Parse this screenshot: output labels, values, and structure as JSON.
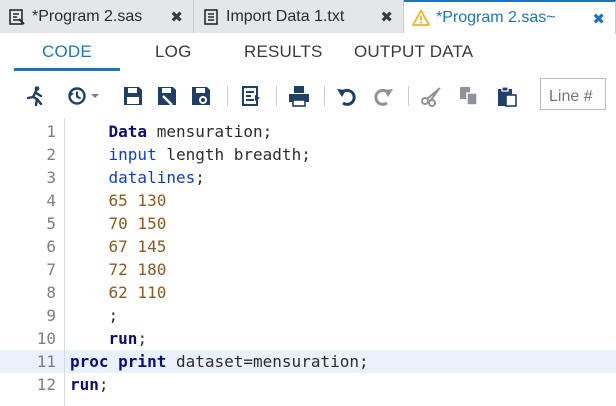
{
  "tabs": [
    {
      "label": "*Program 2.sas",
      "close": "✖",
      "icon": "program-icon",
      "active": false
    },
    {
      "label": "Import Data 1.txt",
      "close": "✖",
      "icon": "document-icon",
      "active": false
    },
    {
      "label": "*Program 2.sas~",
      "close": "✖",
      "icon": "warning-icon",
      "active": true
    }
  ],
  "subtabs": [
    "CODE",
    "LOG",
    "RESULTS",
    "OUTPUT DATA"
  ],
  "toolbar": {
    "line_placeholder": "Line #",
    "icons": [
      "run-icon",
      "history-icon",
      "save-icon",
      "save-as-icon",
      "save-to-icon",
      "format-icon",
      "print-icon",
      "undo-icon",
      "redo-icon",
      "cut-icon",
      "copy-icon",
      "paste-icon"
    ]
  },
  "colors": {
    "accent": "#1e74b9",
    "keyword": "#0b0b80",
    "number": "#8a5a1e",
    "warning": "#f2b21d"
  },
  "editor": {
    "current_line": 11,
    "lines": [
      {
        "n": "1",
        "indent": "    ",
        "tokens": [
          {
            "t": "Data",
            "c": "kw"
          },
          {
            "t": " mensuration;",
            "c": "plain"
          }
        ]
      },
      {
        "n": "2",
        "indent": "    ",
        "tokens": [
          {
            "t": "input",
            "c": "kw2"
          },
          {
            "t": " length breadth;",
            "c": "plain"
          }
        ]
      },
      {
        "n": "3",
        "indent": "    ",
        "tokens": [
          {
            "t": "datalines",
            "c": "kw2"
          },
          {
            "t": ";",
            "c": "plain"
          }
        ]
      },
      {
        "n": "4",
        "indent": "    ",
        "tokens": [
          {
            "t": "65 130",
            "c": "num"
          }
        ]
      },
      {
        "n": "5",
        "indent": "    ",
        "tokens": [
          {
            "t": "70 150",
            "c": "num"
          }
        ]
      },
      {
        "n": "6",
        "indent": "    ",
        "tokens": [
          {
            "t": "67 145",
            "c": "num"
          }
        ]
      },
      {
        "n": "7",
        "indent": "    ",
        "tokens": [
          {
            "t": "72 180",
            "c": "num"
          }
        ]
      },
      {
        "n": "8",
        "indent": "    ",
        "tokens": [
          {
            "t": "62 110",
            "c": "num"
          }
        ]
      },
      {
        "n": "9",
        "indent": "    ",
        "tokens": [
          {
            "t": ";",
            "c": "plain"
          }
        ]
      },
      {
        "n": "10",
        "indent": "    ",
        "tokens": [
          {
            "t": "run",
            "c": "kw"
          },
          {
            "t": ";",
            "c": "plain"
          }
        ]
      },
      {
        "n": "11",
        "indent": "",
        "tokens": [
          {
            "t": "proc print",
            "c": "kw"
          },
          {
            "t": " dataset=mensuration;",
            "c": "plain"
          }
        ]
      },
      {
        "n": "12",
        "indent": "",
        "tokens": [
          {
            "t": "run",
            "c": "kw"
          },
          {
            "t": ";",
            "c": "plain"
          }
        ]
      }
    ]
  }
}
